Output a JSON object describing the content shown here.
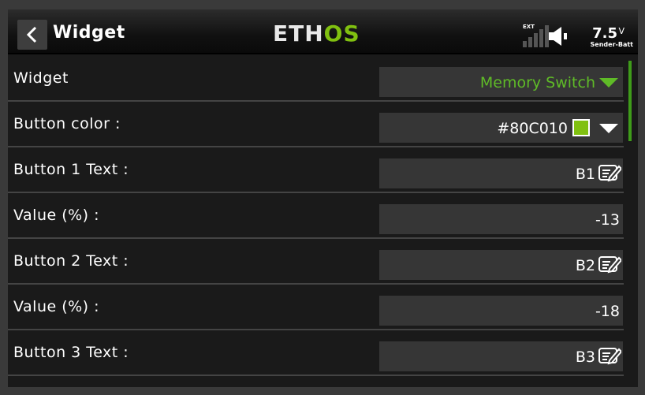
{
  "header": {
    "title": "Widget",
    "logo_left": "ETH",
    "logo_right": "OS",
    "ext_label": "EXT",
    "voltage": "7.5",
    "voltage_unit": "V",
    "battery_label": "Sender-Batt"
  },
  "colors": {
    "accent": "#80C010",
    "dropdown_green": "#5FBB27"
  },
  "rows": [
    {
      "label": "Widget",
      "value": "Memory Switch"
    },
    {
      "label": "Button color :",
      "value": "#80C010",
      "swatch": "#80C010"
    },
    {
      "label": "Button 1 Text :",
      "value": "B1"
    },
    {
      "label": "Value (%) :",
      "value": "-13"
    },
    {
      "label": "Button 2 Text :",
      "value": "B2"
    },
    {
      "label": "Value (%) :",
      "value": "-18"
    },
    {
      "label": "Button 3 Text :",
      "value": "B3"
    }
  ],
  "icons": {
    "back": "chevron-left-icon",
    "speaker": "speaker-icon",
    "signal": "signal-bars-icon",
    "dropdown": "caret-down-icon",
    "edit": "edit-text-icon"
  }
}
